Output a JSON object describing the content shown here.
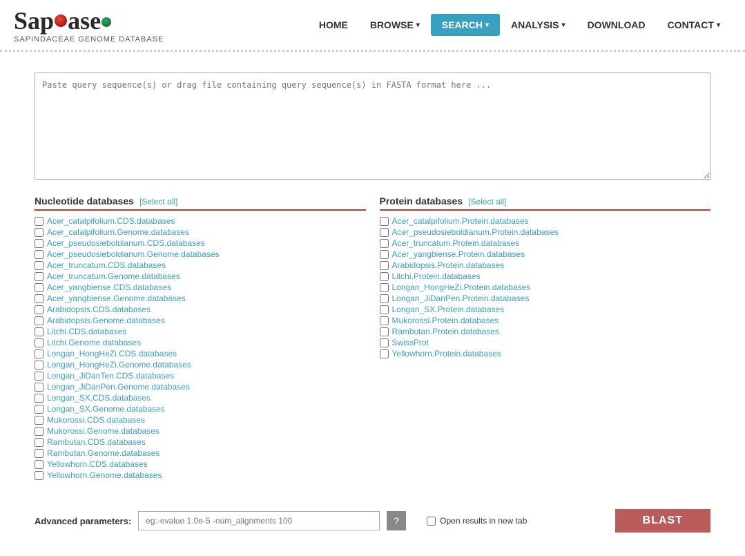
{
  "nav": {
    "logo_title": "SapBase",
    "logo_subtitle": "SAPindaceae Genome dataBase",
    "items": [
      {
        "label": "HOME",
        "has_caret": false,
        "active": false
      },
      {
        "label": "BROWSE",
        "has_caret": true,
        "active": false
      },
      {
        "label": "SEARCH",
        "has_caret": true,
        "active": true
      },
      {
        "label": "ANALYSIS",
        "has_caret": true,
        "active": false
      },
      {
        "label": "DOWNLOAD",
        "has_caret": false,
        "active": false
      },
      {
        "label": "CONTACT",
        "has_caret": true,
        "active": false
      }
    ]
  },
  "query": {
    "placeholder": "Paste query sequence(s) or drag file containing query sequence(s) in FASTA format here ..."
  },
  "nucleotide_db": {
    "title": "Nucleotide databases",
    "select_all": "[Select all]",
    "items": [
      "Acer_catalpifolium.CDS.databases",
      "Acer_catalpifolium.Genome.databases",
      "Acer_pseudosieboldianum.CDS.databases",
      "Acer_pseudosieboldianum.Genome.databases",
      "Acer_truncatum.CDS.databases",
      "Acer_truncatum.Genome.databases",
      "Acer_yangbiense.CDS.databases",
      "Acer_yangbiense.Genome.databases",
      "Arabidopsis.CDS.databases",
      "Arabidopsis.Genome.databases",
      "Litchi.CDS.databases",
      "Litchi.Genome.databases",
      "Longan_HongHeZi.CDS.databases",
      "Longan_HongHeZi.Genome.databases",
      "Longan_JiDanTen.CDS.databases",
      "Longan_JiDanPen.Genome.databases",
      "Longan_SX.CDS.databases",
      "Longan_SX.Genome.databases",
      "Mukorossi.CDS.databases",
      "Mukorossi.Genome.databases",
      "Rambutan.CDS.databases",
      "Rambutan.Genome.databases",
      "Yellowhorn.CDS.databases",
      "Yellowhorn.Genome.databases"
    ]
  },
  "protein_db": {
    "title": "Protein databases",
    "select_all": "[Select all]",
    "items": [
      "Acer_catalpifolium.Protein.databases",
      "Acer_pseudosieboldianum.Protein.databases",
      "Acer_truncatum.Protein.databases",
      "Acer_yangbiense.Protein.databases",
      "Arabidopsis.Protein.databases",
      "Litchi.Protein.databases",
      "Longan_HongHeZi.Protein.databases",
      "Longan_JiDanPen.Protein.databases",
      "Longan_SX.Protein.databases",
      "Mukorossi.Protein.databases",
      "Rambutan.Protein.databases",
      "SwissProt",
      "Yellowhorn.Protein.databases"
    ]
  },
  "advanced": {
    "label": "Advanced parameters:",
    "placeholder": "eg:-evalue 1.0e-5 -num_alignments 100",
    "help_label": "?",
    "open_tab_label": "Open results in new tab",
    "blast_label": "BLAST"
  }
}
